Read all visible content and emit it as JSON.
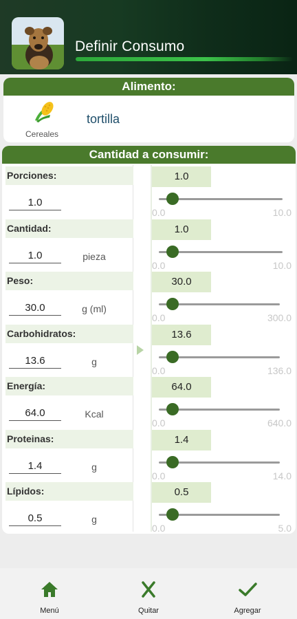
{
  "header": {
    "title": "Definir Consumo",
    "accent_color": "#3cc24a",
    "avatar_icon": "dog-photo"
  },
  "food": {
    "section_title": "Alimento:",
    "category": "Cereales",
    "category_icon": "corn-icon",
    "name": "tortilla"
  },
  "quantity": {
    "section_title": "Cantidad a consumir:",
    "rows": [
      {
        "label": "Porciones:",
        "input": "1.0",
        "unit": "",
        "value": "1.0",
        "min": "0.0",
        "max": "10.0",
        "fraction": 0.1
      },
      {
        "label": "Cantidad:",
        "input": "1.0",
        "unit": "pieza",
        "value": "1.0",
        "min": "0.0",
        "max": "10.0",
        "fraction": 0.1
      },
      {
        "label": "Peso:",
        "input": "30.0",
        "unit": "g (ml)",
        "value": "30.0",
        "min": "0.0",
        "max": "300.0",
        "fraction": 0.1
      },
      {
        "label": "Carbohidratos:",
        "input": "13.6",
        "unit": "g",
        "value": "13.6",
        "min": "0.0",
        "max": "136.0",
        "fraction": 0.1
      },
      {
        "label": "Energía:",
        "input": "64.0",
        "unit": "Kcal",
        "value": "64.0",
        "min": "0.0",
        "max": "640.0",
        "fraction": 0.1
      },
      {
        "label": "Proteinas:",
        "input": "1.4",
        "unit": "g",
        "value": "1.4",
        "min": "0.0",
        "max": "14.0",
        "fraction": 0.1
      },
      {
        "label": "Lípidos:",
        "input": "0.5",
        "unit": "g",
        "value": "0.5",
        "min": "0.0",
        "max": "5.0",
        "fraction": 0.1
      }
    ]
  },
  "nav": {
    "menu_label": "Menú",
    "quitar_label": "Quitar",
    "agregar_label": "Agregar"
  },
  "colors": {
    "primary_green": "#4a7a2c",
    "thumb_green": "#3a6b25",
    "value_box": "#dfeccf"
  }
}
